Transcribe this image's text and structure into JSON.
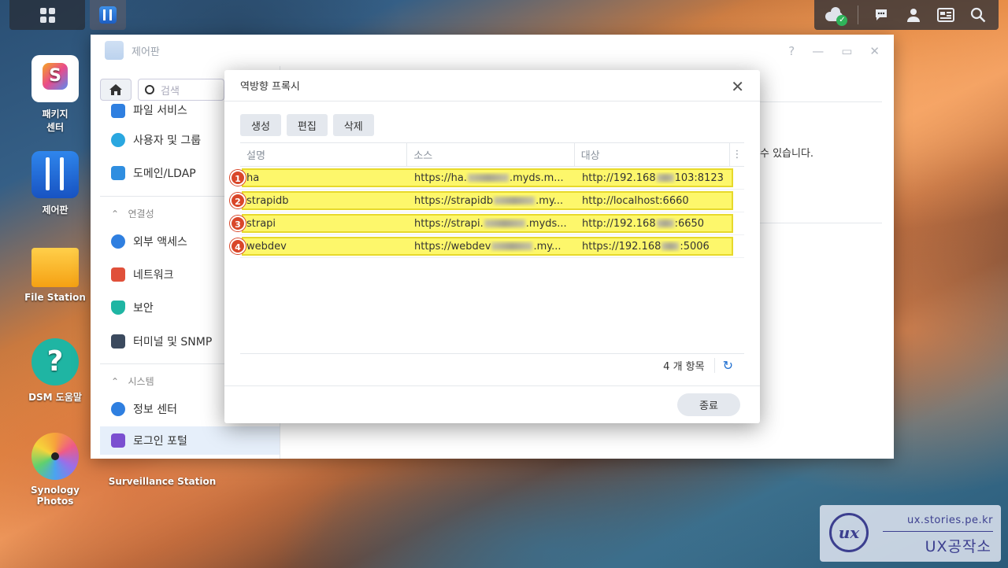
{
  "taskbar": {
    "left": [
      {
        "name": "main-menu"
      },
      {
        "name": "control-panel"
      }
    ],
    "right_icons": [
      "cloud-sync-icon",
      "chat-icon",
      "user-icon",
      "widgets-icon",
      "search-icon"
    ]
  },
  "desktop": {
    "icons": [
      {
        "label_line1": "패키지",
        "label_line2": "센터",
        "icon": "package-center-icon"
      },
      {
        "label_line1": "제어판",
        "label_line2": "",
        "icon": "control-panel-icon"
      },
      {
        "label_line1": "File Station",
        "label_line2": "",
        "icon": "file-station-icon"
      },
      {
        "label_line1": "DSM 도움말",
        "label_line2": "",
        "icon": "help-icon"
      },
      {
        "label_line1": "Synology Photos",
        "label_line2": "",
        "icon": "photos-icon"
      },
      {
        "label_line1": "Surveillance Station",
        "label_line2": "",
        "icon": "surveillance-icon"
      }
    ]
  },
  "control_panel": {
    "title": "제어판",
    "search_placeholder": "검색",
    "nav": {
      "file_services": "파일 서비스",
      "users_groups": "사용자 및 그룹",
      "domain_ldap": "도메인/LDAP",
      "section_connectivity": "연결성",
      "external_access": "외부 액세스",
      "network": "네트워크",
      "security": "보안",
      "terminal_snmp": "터미널 및 SNMP",
      "section_system": "시스템",
      "info_center": "정보 센터",
      "login_portal": "로그인 포털"
    },
    "right_text": "수 있습니다."
  },
  "dialog": {
    "title": "역방향 프록시",
    "buttons": {
      "create": "생성",
      "edit": "편집",
      "delete": "삭제"
    },
    "columns": [
      "설명",
      "소스",
      "대상"
    ],
    "rows": [
      {
        "num": "1",
        "desc": "ha",
        "src_a": "https://ha.",
        "src_b": ".myds.m...",
        "dst_a": "http://192.168",
        "dst_b": "103:8123"
      },
      {
        "num": "2",
        "desc": "strapidb",
        "src_a": "https://strapidb",
        "src_b": ".my...",
        "dst_a": "http://localhost:6660",
        "dst_b": ""
      },
      {
        "num": "3",
        "desc": "strapi",
        "src_a": "https://strapi.",
        "src_b": ".myds...",
        "dst_a": "http://192.168",
        "dst_b": ":6650"
      },
      {
        "num": "4",
        "desc": "webdev",
        "src_a": "https://webdev",
        "src_b": ".my...",
        "dst_a": "https://192.168",
        "dst_b": ":5006"
      }
    ],
    "count": "4 개 항목",
    "close": "종료"
  },
  "watermark": {
    "logo": "ux",
    "url": "ux.stories.pe.kr",
    "title": "UX공작소"
  }
}
